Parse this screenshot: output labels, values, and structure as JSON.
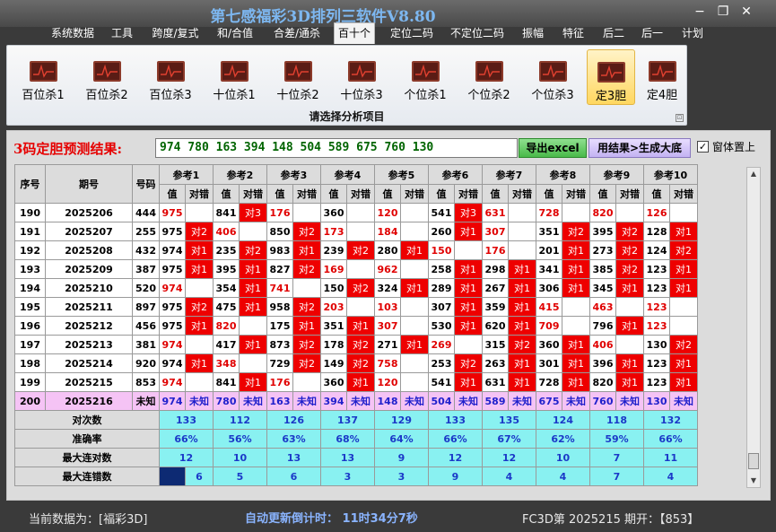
{
  "window": {
    "title": "第七感福彩3D排列三软件V8.80",
    "minimize": "−",
    "restore": "❐",
    "close": "✕"
  },
  "menu": [
    "系统数据",
    "工具",
    "跨度/复式",
    "和/合值",
    "合差/通杀",
    "百十个",
    "定位二码",
    "不定位二码",
    "振幅",
    "特征",
    "后二",
    "后一",
    "计划"
  ],
  "menu_active": "百十个",
  "ribbon": {
    "items": [
      "百位杀1",
      "百位杀2",
      "百位杀3",
      "十位杀1",
      "十位杀2",
      "十位杀3",
      "个位杀1",
      "个位杀2",
      "个位杀3",
      "定3胆",
      "定4胆"
    ],
    "selected": "定3胆",
    "footer": "请选择分析项目",
    "launcher": "⊡"
  },
  "prediction": {
    "label": "3码定胆预测结果:",
    "value": "974 780 163 394 148 504 589 675 760 130",
    "export_button": "导出excel",
    "generate_button": "用结果>生成大底",
    "pin_checked": "✓",
    "pin_label": "窗体置上"
  },
  "table": {
    "col_headers": {
      "seq": "序号",
      "issue": "期号",
      "number": "号码"
    },
    "refs": [
      "参考1",
      "参考2",
      "参考3",
      "参考4",
      "参考5",
      "参考6",
      "参考7",
      "参考8",
      "参考9",
      "参考10"
    ],
    "sub_headers": {
      "value": "值",
      "result": "对错"
    },
    "rows": [
      {
        "seq": "190",
        "issue": "2025206",
        "number": "444",
        "cells": [
          [
            "975",
            "",
            "r"
          ],
          [
            "841",
            "对3",
            ""
          ],
          [
            "176",
            "",
            "r"
          ],
          [
            "360",
            "",
            ""
          ],
          [
            "120",
            "",
            "r"
          ],
          [
            "541",
            "对3",
            ""
          ],
          [
            "631",
            "",
            "r"
          ],
          [
            "728",
            "",
            "r"
          ],
          [
            "820",
            "",
            "r"
          ],
          [
            "126",
            "",
            "r"
          ]
        ]
      },
      {
        "seq": "191",
        "issue": "2025207",
        "number": "255",
        "cells": [
          [
            "975",
            "对2",
            ""
          ],
          [
            "406",
            "",
            "r"
          ],
          [
            "850",
            "对2",
            ""
          ],
          [
            "173",
            "",
            "r"
          ],
          [
            "184",
            "",
            "r"
          ],
          [
            "260",
            "对1",
            ""
          ],
          [
            "307",
            "",
            "r"
          ],
          [
            "351",
            "对2",
            ""
          ],
          [
            "395",
            "对2",
            ""
          ],
          [
            "128",
            "对1",
            ""
          ]
        ]
      },
      {
        "seq": "192",
        "issue": "2025208",
        "number": "432",
        "cells": [
          [
            "974",
            "对1",
            ""
          ],
          [
            "235",
            "对2",
            ""
          ],
          [
            "983",
            "对1",
            ""
          ],
          [
            "239",
            "对2",
            ""
          ],
          [
            "280",
            "对1",
            ""
          ],
          [
            "150",
            "",
            "r"
          ],
          [
            "176",
            "",
            "r"
          ],
          [
            "201",
            "对1",
            ""
          ],
          [
            "273",
            "对2",
            ""
          ],
          [
            "124",
            "对2",
            ""
          ]
        ]
      },
      {
        "seq": "193",
        "issue": "2025209",
        "number": "387",
        "cells": [
          [
            "975",
            "对1",
            ""
          ],
          [
            "395",
            "对1",
            ""
          ],
          [
            "827",
            "对2",
            ""
          ],
          [
            "169",
            "",
            "r"
          ],
          [
            "962",
            "",
            "r"
          ],
          [
            "258",
            "对1",
            ""
          ],
          [
            "298",
            "对1",
            ""
          ],
          [
            "341",
            "对1",
            ""
          ],
          [
            "385",
            "对2",
            ""
          ],
          [
            "123",
            "对1",
            ""
          ]
        ]
      },
      {
        "seq": "194",
        "issue": "2025210",
        "number": "520",
        "cells": [
          [
            "974",
            "",
            "r"
          ],
          [
            "354",
            "对1",
            ""
          ],
          [
            "741",
            "",
            "r"
          ],
          [
            "150",
            "对2",
            ""
          ],
          [
            "324",
            "对1",
            ""
          ],
          [
            "289",
            "对1",
            ""
          ],
          [
            "267",
            "对1",
            ""
          ],
          [
            "306",
            "对1",
            ""
          ],
          [
            "345",
            "对1",
            ""
          ],
          [
            "123",
            "对1",
            ""
          ]
        ]
      },
      {
        "seq": "195",
        "issue": "2025211",
        "number": "897",
        "cells": [
          [
            "975",
            "对2",
            ""
          ],
          [
            "475",
            "对1",
            ""
          ],
          [
            "958",
            "对2",
            ""
          ],
          [
            "203",
            "",
            "r"
          ],
          [
            "103",
            "",
            "r"
          ],
          [
            "307",
            "对1",
            ""
          ],
          [
            "359",
            "对1",
            ""
          ],
          [
            "415",
            "",
            "r"
          ],
          [
            "463",
            "",
            "r"
          ],
          [
            "123",
            "",
            "r"
          ]
        ]
      },
      {
        "seq": "196",
        "issue": "2025212",
        "number": "456",
        "cells": [
          [
            "975",
            "对1",
            ""
          ],
          [
            "820",
            "",
            "r"
          ],
          [
            "175",
            "对1",
            ""
          ],
          [
            "351",
            "对1",
            ""
          ],
          [
            "307",
            "",
            "r"
          ],
          [
            "530",
            "对1",
            ""
          ],
          [
            "620",
            "对1",
            ""
          ],
          [
            "709",
            "",
            "r"
          ],
          [
            "796",
            "对1",
            ""
          ],
          [
            "123",
            "",
            "r"
          ]
        ]
      },
      {
        "seq": "197",
        "issue": "2025213",
        "number": "381",
        "cells": [
          [
            "974",
            "",
            "r"
          ],
          [
            "417",
            "对1",
            ""
          ],
          [
            "873",
            "对2",
            ""
          ],
          [
            "178",
            "对2",
            ""
          ],
          [
            "271",
            "对1",
            ""
          ],
          [
            "269",
            "",
            "r"
          ],
          [
            "315",
            "对2",
            ""
          ],
          [
            "360",
            "对1",
            ""
          ],
          [
            "406",
            "",
            "r"
          ],
          [
            "130",
            "对2",
            ""
          ]
        ]
      },
      {
        "seq": "198",
        "issue": "2025214",
        "number": "920",
        "cells": [
          [
            "974",
            "对1",
            ""
          ],
          [
            "348",
            "",
            "r"
          ],
          [
            "729",
            "对2",
            ""
          ],
          [
            "149",
            "对2",
            ""
          ],
          [
            "758",
            "",
            "r"
          ],
          [
            "253",
            "对2",
            ""
          ],
          [
            "263",
            "对1",
            ""
          ],
          [
            "301",
            "对1",
            ""
          ],
          [
            "396",
            "对1",
            ""
          ],
          [
            "123",
            "对1",
            ""
          ]
        ]
      },
      {
        "seq": "199",
        "issue": "2025215",
        "number": "853",
        "cells": [
          [
            "974",
            "",
            "r"
          ],
          [
            "841",
            "对1",
            ""
          ],
          [
            "176",
            "",
            "r"
          ],
          [
            "360",
            "对1",
            ""
          ],
          [
            "120",
            "",
            "r"
          ],
          [
            "541",
            "对1",
            ""
          ],
          [
            "631",
            "对1",
            ""
          ],
          [
            "728",
            "对1",
            ""
          ],
          [
            "820",
            "对1",
            ""
          ],
          [
            "123",
            "对1",
            ""
          ]
        ]
      }
    ],
    "pred_row": {
      "seq": "200",
      "issue": "2025216",
      "number": "未知",
      "values": [
        "974",
        "780",
        "163",
        "394",
        "148",
        "504",
        "589",
        "675",
        "760",
        "130"
      ],
      "unknown": "未知"
    },
    "stats": [
      {
        "label": "对次数",
        "values": [
          "133",
          "112",
          "126",
          "137",
          "129",
          "133",
          "135",
          "124",
          "118",
          "132"
        ]
      },
      {
        "label": "准确率",
        "values": [
          "66%",
          "56%",
          "63%",
          "68%",
          "64%",
          "66%",
          "67%",
          "62%",
          "59%",
          "66%"
        ]
      },
      {
        "label": "最大连对数",
        "values": [
          "12",
          "10",
          "13",
          "13",
          "9",
          "12",
          "12",
          "10",
          "7",
          "11"
        ]
      },
      {
        "label": "最大连错数",
        "values": [
          "6",
          "5",
          "6",
          "3",
          "3",
          "9",
          "4",
          "4",
          "7",
          "4"
        ]
      }
    ]
  },
  "status": {
    "current": "当前数据为：[福彩3D]",
    "countdown": "自动更新倒计时：  11时34分7秒",
    "issue": "FC3D第 2025215 期开：【853】"
  }
}
